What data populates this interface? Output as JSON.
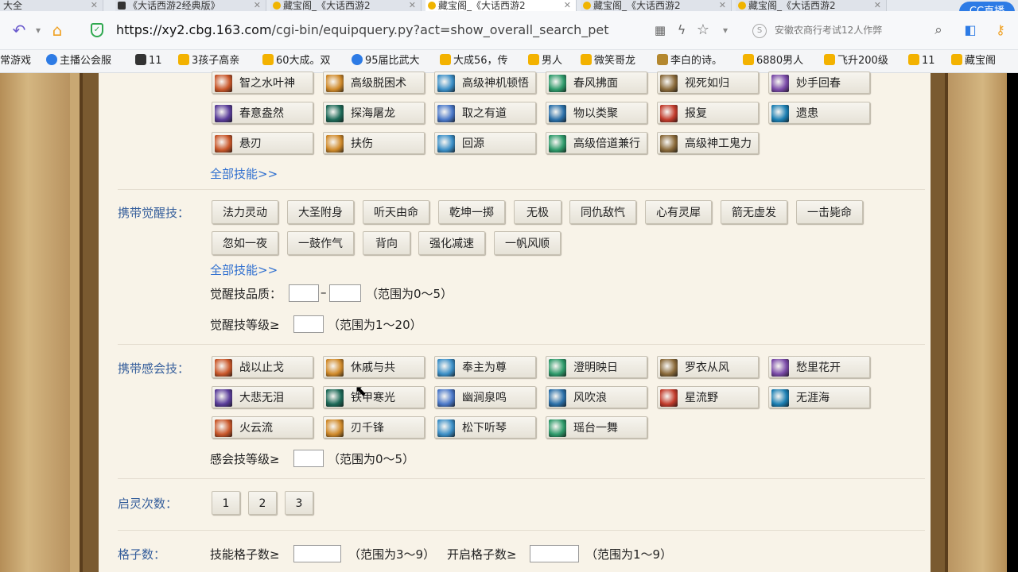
{
  "browser": {
    "tabs": [
      {
        "label": "大全"
      },
      {
        "label": "《大话西游2经典版》"
      },
      {
        "label": "藏宝阁_《大话西游2"
      },
      {
        "label": "藏宝阁_《大话西游2"
      },
      {
        "label": "藏宝阁_《大话西游2"
      },
      {
        "label": "藏宝阁_《大话西游2"
      }
    ],
    "badge": "CC直播",
    "url_host": "https://xy2.cbg.163.com",
    "url_path": "/cgi-bin/equipquery.py?act=show_overall_search_pet",
    "search_placeholder": "安徽农商行考试12人作弊",
    "bookmarks": [
      "常游戏",
      "主播公会服",
      "11",
      "3孩子高亲",
      "60大成。双",
      "95届比武大",
      "大成56，传",
      "男人",
      "微笑哥龙",
      "李白的诗。",
      "6880男人",
      "飞升200级",
      "11",
      "藏宝阁"
    ]
  },
  "skills_top": [
    "智之水叶神",
    "高级脱困术",
    "高级神机顿悟",
    "春风拂面",
    "视死如归",
    "妙手回春",
    "春意盎然",
    "探海屠龙",
    "取之有道",
    "物以类聚",
    "报复",
    "遗患",
    "悬刃",
    "扶伤",
    "回源",
    "高级倍道兼行",
    "高级神工鬼力"
  ],
  "more_link": "全部技能>>",
  "awaken": {
    "label": "携带觉醒技：",
    "skills": [
      "法力灵动",
      "大圣附身",
      "听天由命",
      "乾坤一掷",
      "无极",
      "同仇敌忾",
      "心有灵犀",
      "箭无虚发",
      "一击毙命",
      "忽如一夜",
      "一鼓作气",
      "背向",
      "强化减速",
      "一帆风顺"
    ],
    "more_link": "全部技能>>",
    "quality_label": "觉醒技品质：",
    "quality_dash": "–",
    "quality_range": "（范围为0～5）",
    "level_label": "觉醒技等级≥",
    "level_range": "（范围为1～20）"
  },
  "ganhui": {
    "label": "携带感会技：",
    "skills": [
      "战以止戈",
      "休戚与共",
      "奉主为尊",
      "澄明映日",
      "罗衣从风",
      "愁里花开",
      "大悲无泪",
      "铁甲寒光",
      "幽涧泉鸣",
      "风吹浪",
      "星流野",
      "无涯海",
      "火云流",
      "刃千锋",
      "松下听琴",
      "瑶台一舞"
    ],
    "level_label": "感会技等级≥",
    "level_range": "（范围为0～5）"
  },
  "qiling": {
    "label": "启灵次数：",
    "options": [
      "1",
      "2",
      "3"
    ]
  },
  "grid": {
    "label": "格子数：",
    "skill_label": "技能格子数≥",
    "skill_range": "（范围为3～9）",
    "open_label": "开启格子数≥",
    "open_range": "（范围为1～9）"
  }
}
